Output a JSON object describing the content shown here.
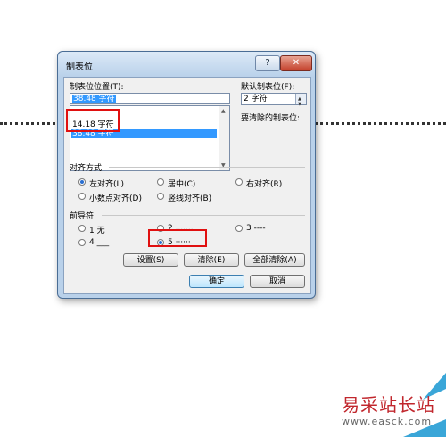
{
  "dialog": {
    "title": "制表位",
    "help_label": "?",
    "close_label": "✕",
    "tab_stop_label": "制表位位置(T):",
    "tab_stop_value": "38.48 字符",
    "tab_stop_list": [
      "14.18 字符",
      "38.48 字符"
    ],
    "default_label": "默认制表位(F):",
    "default_value": "2 字符",
    "clear_label": "要清除的制表位:",
    "alignment": {
      "label": "对齐方式",
      "options": [
        "左对齐(L)",
        "居中(C)",
        "右对齐(R)",
        "小数点对齐(D)",
        "竖线对齐(B)"
      ],
      "selected": "左对齐(L)"
    },
    "leader": {
      "label": "前导符",
      "options": [
        "1 无",
        "2 .......",
        "3 ----",
        "4 ___",
        "5 ······"
      ],
      "selected": "5 ······"
    },
    "buttons": {
      "set": "设置(S)",
      "clear": "清除(E)",
      "clear_all": "全部清除(A)",
      "ok": "确定",
      "cancel": "取消"
    }
  },
  "watermark": {
    "name": "易采站长站",
    "url": "www.easck.com"
  },
  "colors": {
    "highlight": "#3399ff",
    "annotation_red": "#e01010",
    "watermark_red": "#c1272d"
  }
}
